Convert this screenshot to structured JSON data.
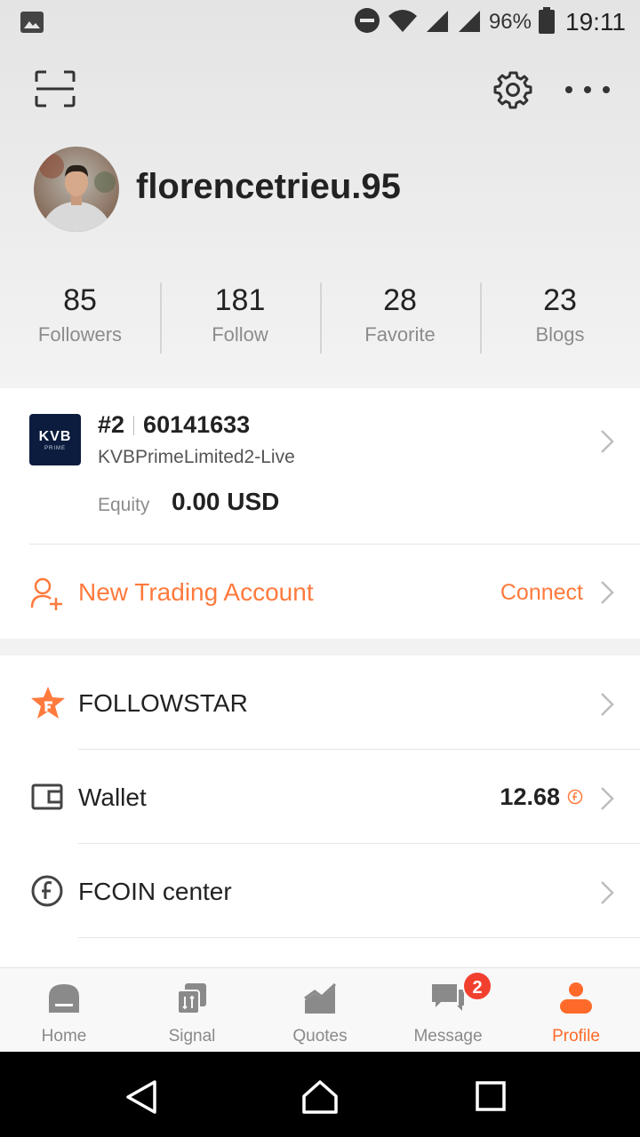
{
  "status_bar": {
    "battery_percent": "96%",
    "time": "19:11"
  },
  "profile": {
    "username": "florencetrieu.95",
    "stats": [
      {
        "value": "85",
        "label": "Followers"
      },
      {
        "value": "181",
        "label": "Follow"
      },
      {
        "value": "28",
        "label": "Favorite"
      },
      {
        "value": "23",
        "label": "Blogs"
      }
    ]
  },
  "account": {
    "logo_text": "KVB",
    "logo_subtext": "PRIME",
    "rank": "#2",
    "number": "60141633",
    "server": "KVBPrimeLimited2-Live",
    "equity_label": "Equity",
    "equity_value": "0.00 USD"
  },
  "new_account": {
    "label": "New Trading Account",
    "action": "Connect"
  },
  "menu": {
    "followstar": "FOLLOWSTAR",
    "wallet": "Wallet",
    "wallet_value": "12.68",
    "fcoin": "FCOIN center"
  },
  "bottom_nav": {
    "items": [
      "Home",
      "Signal",
      "Quotes",
      "Message",
      "Profile"
    ],
    "message_badge": "2",
    "active": "Profile"
  },
  "colors": {
    "accent": "#ff7a3d",
    "badge": "#f2402f",
    "nav_inactive": "#8a8a8a"
  }
}
